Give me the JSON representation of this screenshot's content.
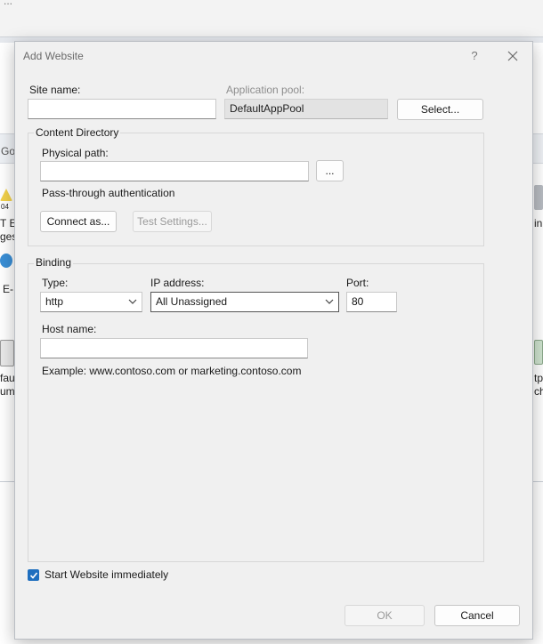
{
  "background": {
    "top_text": "...",
    "bar_text": "Go",
    "frag_1": "T Er",
    "frag_2": "ges",
    "frag_3": "E-",
    "frag_4": "fau",
    "frag_5": "um",
    "frag_6": "in",
    "frag_7": "tp",
    "frag_8": "ch",
    "warning_badge": "04"
  },
  "dialog": {
    "title": "Add Website",
    "help": "?",
    "site_name": {
      "label": "Site name:",
      "value": ""
    },
    "app_pool": {
      "label": "Application pool:",
      "value": "DefaultAppPool",
      "select_label": "Select..."
    },
    "content_directory": {
      "title": "Content Directory",
      "physical_path_label": "Physical path:",
      "physical_path_value": "",
      "browse_label": "...",
      "pass_through_label": "Pass-through authentication",
      "connect_as_label": "Connect as...",
      "test_settings_label": "Test Settings..."
    },
    "binding": {
      "title": "Binding",
      "type_label": "Type:",
      "type_value": "http",
      "ip_label": "IP address:",
      "ip_value": "All Unassigned",
      "port_label": "Port:",
      "port_value": "80",
      "host_label": "Host name:",
      "host_value": "",
      "example": "Example: www.contoso.com or marketing.contoso.com"
    },
    "start_immediately": {
      "label": "Start Website immediately",
      "checked": true
    },
    "ok_label": "OK",
    "cancel_label": "Cancel"
  },
  "colors": {
    "accent": "#1f6fbf",
    "dialog_bg": "#f0f0f0"
  }
}
